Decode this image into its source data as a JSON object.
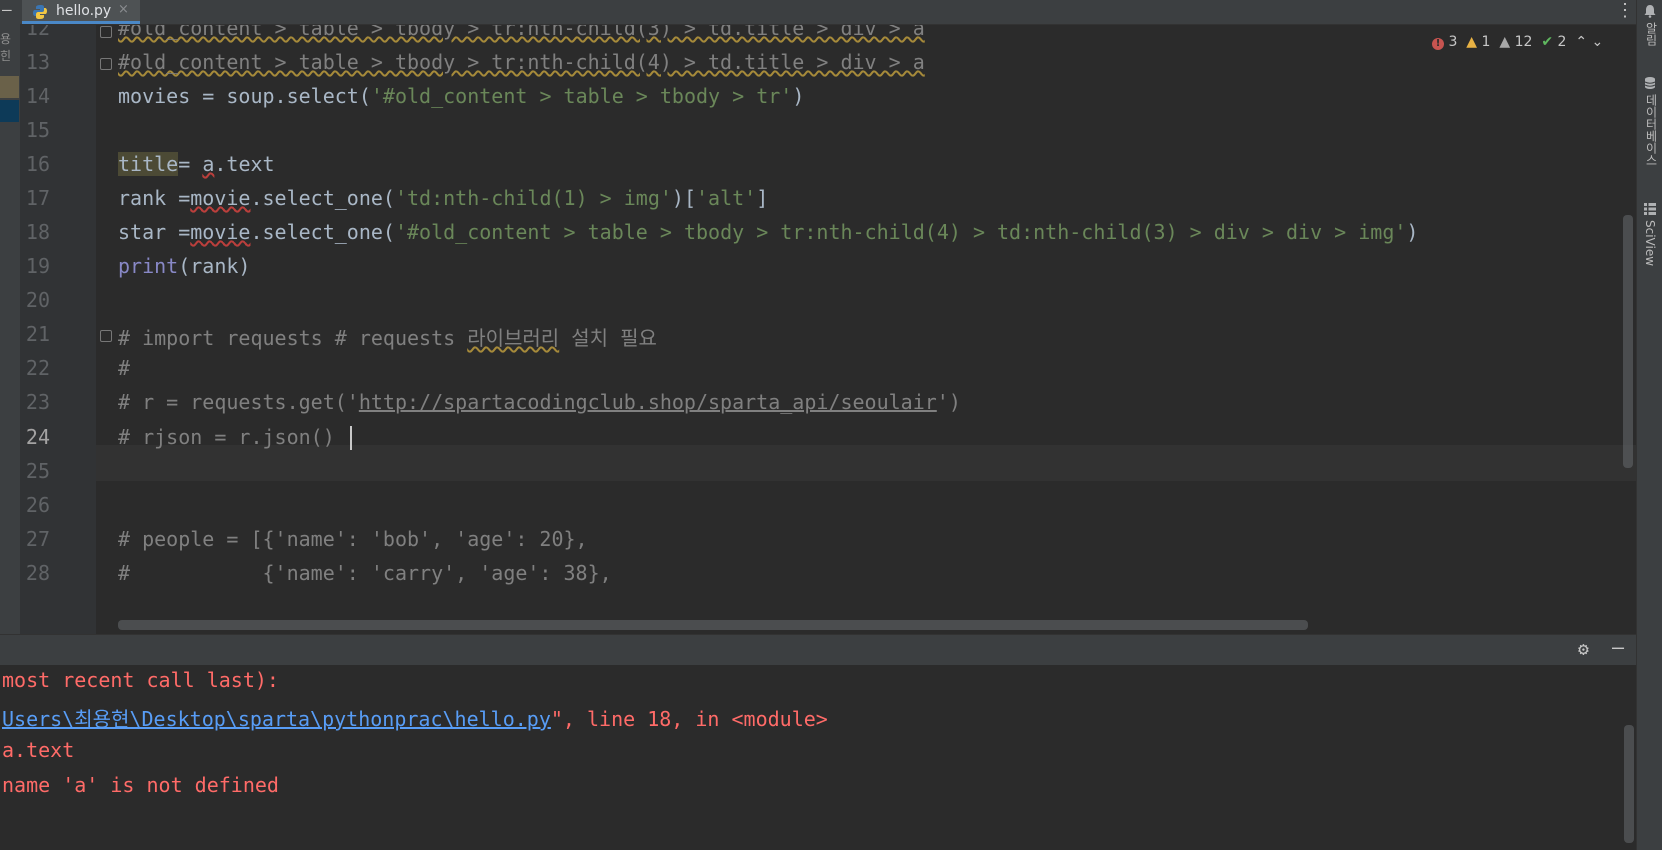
{
  "tab": {
    "filename": "hello.py",
    "close": "×",
    "menu": "⋮"
  },
  "left_panel": {
    "collapse_glyph": "—",
    "label": "용힌"
  },
  "right_panel": {
    "tools": [
      "알림",
      "데이터베이스",
      "SciView"
    ]
  },
  "inspection": {
    "errors": "3",
    "warnings": "1",
    "weak_warnings": "12",
    "typos": "2"
  },
  "editor": {
    "line_numbers": [
      "12",
      "13",
      "14",
      "15",
      "16",
      "17",
      "18",
      "19",
      "20",
      "21",
      "22",
      "23",
      "24",
      "25",
      "26",
      "27",
      "28"
    ],
    "current_line": "24"
  },
  "code_text": {
    "l12": "#old_content > table > tbody > tr:nth-child(3) > td.title > div > a",
    "l13": "#old_content > table > tbody > tr:nth-child(4) > td.title > div > a",
    "l14_a": "movies = soup.select(",
    "l14_b": "'#old_content > table > tbody > tr'",
    "l14_c": ")",
    "l16_a": "title",
    "l16_b": "= ",
    "l16_c": "a",
    "l16_d": ".text",
    "l17_a": "rank =",
    "l17_b": "movie",
    "l17_c": ".select_one(",
    "l17_d": "'td:nth-child(1) > img'",
    "l17_e": ")[",
    "l17_f": "'alt'",
    "l17_g": "]",
    "l18_a": "star =",
    "l18_b": "movie",
    "l18_c": ".select_one(",
    "l18_d": "'#old_content > table > tbody > tr:nth-child(4) > td:nth-child(3) > div > div > img'",
    "l18_e": ")",
    "l19_a": "print",
    "l19_b": "(rank)",
    "l21_a": "# import requests # requests ",
    "l21_b": "라이브러리",
    "l21_c": " 설치 필요",
    "l22": "#",
    "l23_a": "# r = requests.get('",
    "l23_b": "http://spartacodingclub.shop/sparta_api/seoulair",
    "l23_c": "')",
    "l24": "# rjson = r.json()",
    "l27": "# people = [{'name': 'bob', 'age': 20},",
    "l28": "#           {'name': 'carry', 'age': 38},"
  },
  "console": {
    "line1": "most recent call last):",
    "line2_link": "Users\\최용현\\Desktop\\sparta\\pythonprac\\hello.py",
    "line2_rest": "\", line 18, in <module>",
    "line3": "a.text",
    "line4": "name 'a' is not defined"
  },
  "colors": {
    "comment": "#808080",
    "string": "#6a8759",
    "error": "#ff6b68",
    "link": "#589df6",
    "builtin": "#8888c6"
  }
}
